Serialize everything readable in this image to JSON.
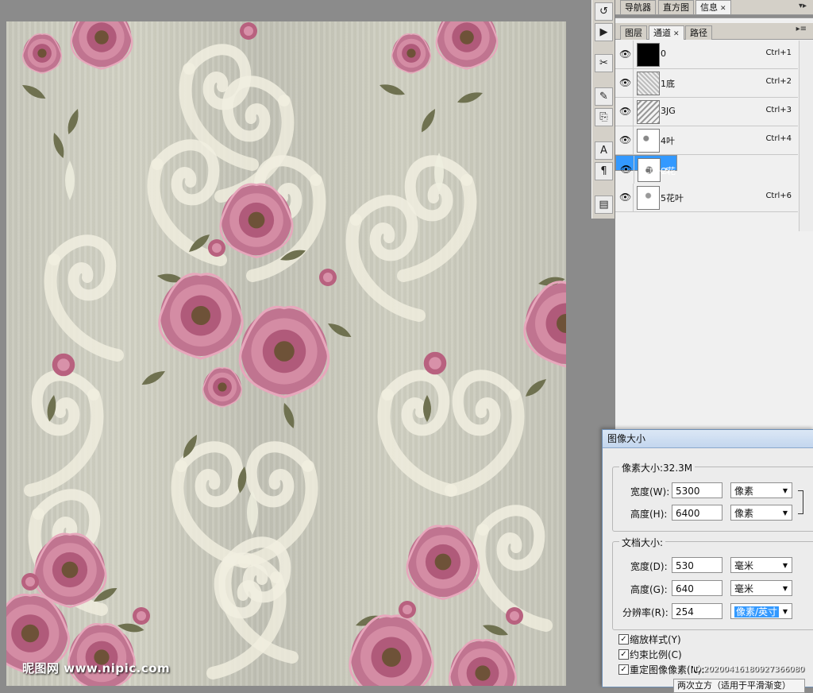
{
  "top_panel": {
    "tabs": [
      {
        "label": "导航器",
        "active": false
      },
      {
        "label": "直方图",
        "active": false
      },
      {
        "label": "信息",
        "active": true
      }
    ]
  },
  "channels_panel": {
    "tabs": [
      {
        "label": "图层",
        "active": false
      },
      {
        "label": "通道",
        "active": true
      },
      {
        "label": "路径",
        "active": false
      }
    ],
    "rows": [
      {
        "name": "0",
        "shortcut": "Ctrl+1",
        "selected": false,
        "thumb": "black"
      },
      {
        "name": "1底",
        "shortcut": "Ctrl+2",
        "selected": false,
        "thumb": "texture"
      },
      {
        "name": "3JG",
        "shortcut": "Ctrl+3",
        "selected": false,
        "thumb": "texture"
      },
      {
        "name": "4叶",
        "shortcut": "Ctrl+4",
        "selected": false,
        "thumb": "light"
      },
      {
        "name": "2花",
        "shortcut": "Ctrl+5",
        "selected": true,
        "thumb": "light"
      },
      {
        "name": "5花叶",
        "shortcut": "Ctrl+6",
        "selected": false,
        "thumb": "light"
      }
    ]
  },
  "toolstrip": {
    "icons": [
      "history-icon",
      "action-play-icon",
      "tools-icon",
      "brush-icon",
      "clone-icon",
      "character-icon",
      "paragraph-icon",
      "layer-comps-icon"
    ]
  },
  "dialog": {
    "title": "图像大小",
    "pixel_dimensions": {
      "title": "像素大小:32.3M",
      "width_label": "宽度(W):",
      "width_value": "5300",
      "width_unit": "像素",
      "height_label": "高度(H):",
      "height_value": "6400",
      "height_unit": "像素"
    },
    "document_size": {
      "title": "文档大小:",
      "width_label": "宽度(D):",
      "width_value": "530",
      "width_unit": "毫米",
      "height_label": "高度(G):",
      "height_value": "640",
      "height_unit": "毫米",
      "resolution_label": "分辨率(R):",
      "resolution_value": "254",
      "resolution_unit": "像素/英寸"
    },
    "checkboxes": [
      {
        "label": "缩放样式(Y)",
        "checked": true
      },
      {
        "label": "约束比例(C)",
        "checked": true
      },
      {
        "label": "重定图像像素(N):",
        "checked": true
      }
    ],
    "resample_method": "两次立方（适用于平滑渐变）"
  },
  "watermark": {
    "site": "昵图网 www.nipic.com",
    "id": "ID:20200416180927366080"
  },
  "colors": {
    "selection": "#3399ff",
    "panel_bg": "#f0f0f0",
    "flower": "#b4607e",
    "leaf": "#6b6b4a",
    "scroll": "#efeedf"
  }
}
